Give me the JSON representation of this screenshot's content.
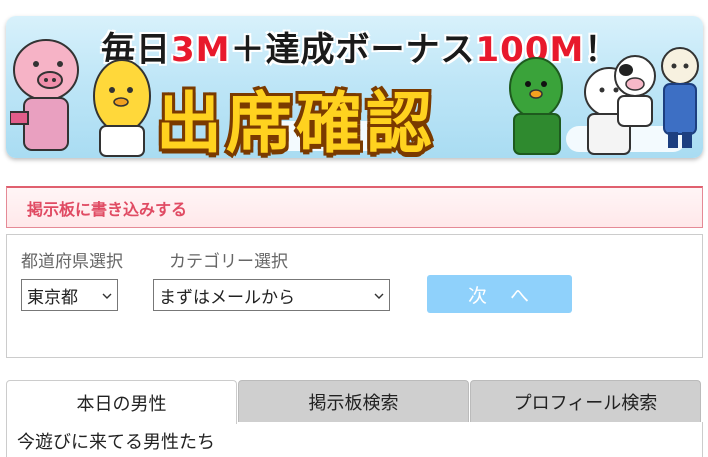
{
  "banner": {
    "headline_prefix": "毎日",
    "headline_red1": "3M",
    "headline_mid": "＋達成ボーナス",
    "headline_red2": "100M",
    "headline_suffix": "！",
    "title": "出席確認"
  },
  "board_link": {
    "label": "掲示板に書き込みする"
  },
  "search": {
    "prefecture_label": "都道府県選択",
    "category_label": "カテゴリー選択",
    "prefecture_value": "東京都",
    "category_value": "まずはメールから",
    "next_label": "次　へ"
  },
  "tabs": [
    {
      "label": "本日の男性",
      "active": true
    },
    {
      "label": "掲示板検索",
      "active": false
    },
    {
      "label": "プロフィール検索",
      "active": false
    }
  ],
  "tab_content": {
    "heading": "今遊びに来てる男性たち"
  },
  "colors": {
    "accent_pink": "#e04b63",
    "button_blue": "#8fd1fb",
    "banner_yellow": "#ffd21f",
    "banner_red": "#e8192c"
  }
}
